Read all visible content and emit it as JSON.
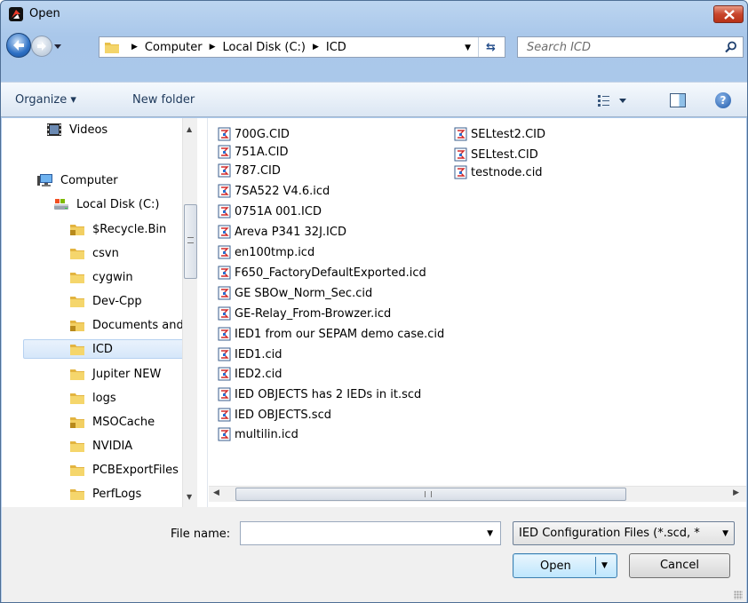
{
  "window": {
    "title": "Open",
    "close_label": "✕"
  },
  "address": {
    "crumbs": [
      "Computer",
      "Local Disk (C:)",
      "ICD"
    ],
    "search_placeholder": "Search ICD"
  },
  "toolbar": {
    "organize": "Organize ▾",
    "new_folder": "New folder",
    "help": "?"
  },
  "nav": {
    "items": [
      {
        "label": "Videos",
        "icon": "video-icon"
      },
      {
        "label": "Computer",
        "icon": "computer-icon"
      },
      {
        "label": "Local Disk (C:)",
        "icon": "drive-icon"
      },
      {
        "label": "$Recycle.Bin",
        "icon": "locked-folder-icon"
      },
      {
        "label": "csvn",
        "icon": "folder-icon"
      },
      {
        "label": "cygwin",
        "icon": "folder-icon"
      },
      {
        "label": "Dev-Cpp",
        "icon": "folder-icon"
      },
      {
        "label": "Documents and",
        "icon": "locked-folder-icon"
      },
      {
        "label": "ICD",
        "icon": "folder-icon",
        "selected": true
      },
      {
        "label": "Jupiter NEW",
        "icon": "folder-icon"
      },
      {
        "label": "logs",
        "icon": "folder-icon"
      },
      {
        "label": "MSOCache",
        "icon": "locked-folder-icon"
      },
      {
        "label": "NVIDIA",
        "icon": "folder-icon"
      },
      {
        "label": "PCBExportFiles",
        "icon": "folder-icon"
      },
      {
        "label": "PerfLogs",
        "icon": "folder-icon"
      }
    ]
  },
  "files": {
    "column1": [
      "700G.CID",
      "751A.CID",
      "787.CID",
      "7SA522 V4.6.icd",
      "0751A 001.ICD",
      "Areva P341 32J.ICD",
      "en100tmp.icd",
      "F650_FactoryDefaultExported.icd",
      "GE SBOw_Norm_Sec.cid",
      "GE-Relay_From-Browzer.icd",
      "IED1 from our SEPAM demo case.cid",
      "IED1.cid",
      "IED2.cid",
      "IED OBJECTS has 2 IEDs in it.scd",
      "IED OBJECTS.scd",
      "multilin.icd"
    ],
    "column2": [
      "SELtest2.CID",
      "SELtest.CID",
      "testnode.cid"
    ],
    "icon": "icd-file-icon"
  },
  "bottom": {
    "file_name_label": "File name:",
    "file_name_value": "",
    "filter_value": "IED Configuration Files (*.scd, *",
    "open_label": "Open",
    "cancel_label": "Cancel"
  }
}
